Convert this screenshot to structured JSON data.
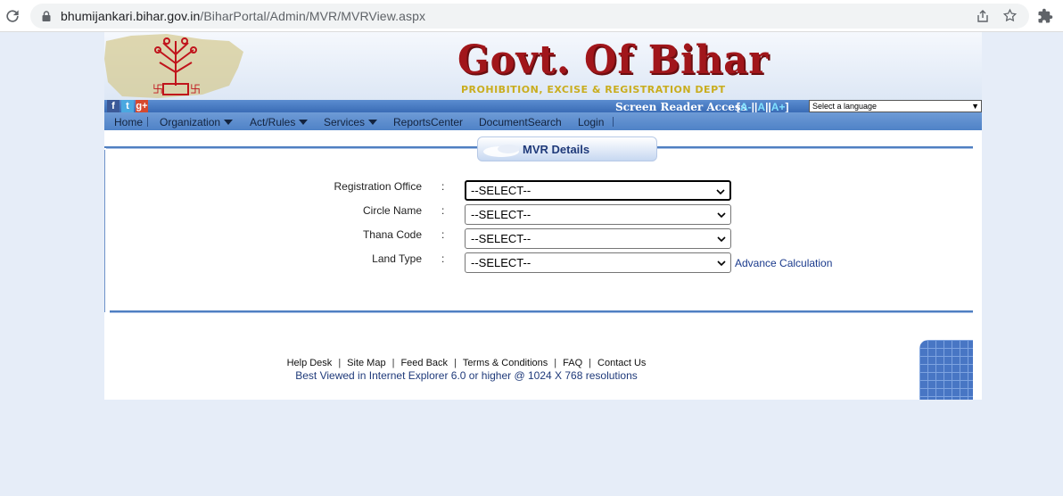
{
  "browser": {
    "url_host": "bhumijankari.bihar.gov.in",
    "url_path": "/BiharPortal/Admin/MVR/MVRView.aspx"
  },
  "header": {
    "title": "Govt. Of Bihar",
    "subtitle": "PROHIBITION, EXCISE & REGISTRATION DEPT"
  },
  "accessbar": {
    "social": [
      "f",
      "t",
      "g+"
    ],
    "screen_reader": "Screen Reader Access",
    "font_sizes": [
      "A-",
      "A",
      "A+"
    ],
    "language_select": "Select a language"
  },
  "menu": {
    "home": "Home",
    "organization": "Organization",
    "act_rules": "Act/Rules",
    "services": "Services",
    "reports": "ReportsCenter",
    "docsearch": "DocumentSearch",
    "login": "Login"
  },
  "section": {
    "title": "MVR Details"
  },
  "form": {
    "colon": ":",
    "registration_office": {
      "label": "Registration Office",
      "value": "--SELECT--"
    },
    "circle_name": {
      "label": "Circle Name",
      "value": "--SELECT--"
    },
    "thana_code": {
      "label": "Thana Code",
      "value": "--SELECT--"
    },
    "land_type": {
      "label": "Land Type",
      "value": "--SELECT--"
    },
    "advance_link": "Advance Calculation"
  },
  "footer": {
    "links": [
      "Help Desk",
      "Site Map",
      "Feed Back",
      "Terms & Conditions",
      "FAQ",
      "Contact Us"
    ],
    "best_viewed": "Best Viewed in Internet Explorer 6.0 or higher @ 1024 X 768 resolutions"
  }
}
